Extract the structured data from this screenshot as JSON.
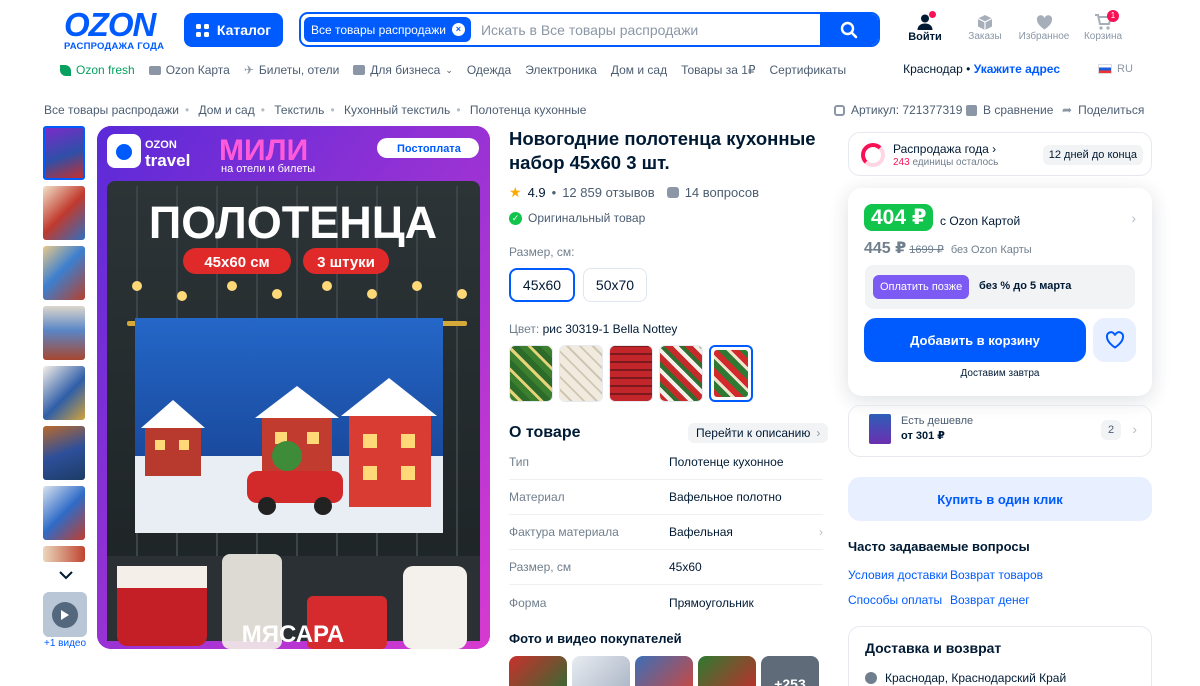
{
  "header": {
    "logo": "OZON",
    "logo_sub": "РАСПРОДАЖА ГОДА",
    "catalog": "Каталог",
    "search_scope": "Все товары распродажи",
    "search_placeholder": "Искать в Все товары распродажи",
    "nav": [
      {
        "label": "Войти",
        "icon": "user-icon"
      },
      {
        "label": "Заказы",
        "icon": "box-icon"
      },
      {
        "label": "Избранное",
        "icon": "heart-icon"
      },
      {
        "label": "Корзина",
        "icon": "cart-icon",
        "count": "1"
      }
    ]
  },
  "subnav": {
    "items": [
      "Ozon fresh",
      "Ozon Карта",
      "Билеты, отели",
      "Для бизнеса",
      "Одежда",
      "Электроника",
      "Дом и сад",
      "Товары за 1₽",
      "Сертификаты"
    ],
    "city": "Краснодар",
    "address": "Укажите адрес",
    "lang": "RU"
  },
  "breadcrumbs": [
    "Все товары распродажи",
    "Дом и сад",
    "Текстиль",
    "Кухонный текстиль",
    "Полотенца кухонные"
  ],
  "meta": {
    "article": "Артикул: 721377319",
    "compare": "В сравнение",
    "share": "Поделиться"
  },
  "gallery": {
    "video_label": "+1 видео",
    "hero": {
      "brand1": "OZON",
      "brand2": "travel",
      "promo": "МИЛИ",
      "promo_sub": "на отели и билеты",
      "postpay": "Постоплата",
      "headline": "ПОЛОТЕНЦА",
      "tag_size": "45х60 см",
      "tag_qty": "3 штуки",
      "bottom": "МЯСАРА"
    }
  },
  "product": {
    "title": "Новогодние полотенца кухонные набор 45х60 3 шт.",
    "rating": "4.9",
    "reviews": "12 859 отзывов",
    "questions": "14 вопросов",
    "original": "Оригинальный товар",
    "size_label": "Размер, см:",
    "sizes": [
      "45x60",
      "50x70"
    ],
    "color_label": "Цвет:",
    "color_value": "рис 30319-1 Bella Nottey",
    "about_title": "О товаре",
    "go_description": "Перейти к описанию",
    "properties": [
      {
        "k": "Тип",
        "v": "Полотенце кухонное"
      },
      {
        "k": "Материал",
        "v": "Вафельное полотно"
      },
      {
        "k": "Фактура материала",
        "v": "Вафельная"
      },
      {
        "k": "Размер, см",
        "v": "45x60"
      },
      {
        "k": "Форма",
        "v": "Прямоугольник"
      }
    ],
    "photos_title": "Фото и видео покупателей",
    "photos_more": "+253"
  },
  "buybox": {
    "sale_title": "Распродажа года",
    "sale_count": "243",
    "sale_count_text": "единицы осталось",
    "sale_days": "12 дней до конца",
    "price": "404 ₽",
    "price_note": "с Ozon Картой",
    "price_regular": "445 ₽",
    "price_old": "1699 ₽",
    "price_regular_note": "без Ozon Карты",
    "pay_later": "Оплатить позже",
    "pay_later_note": "без % до 5 марта",
    "add_to_cart": "Добавить в корзину",
    "delivery_note": "Доставим завтра",
    "cheaper_title": "Есть дешевле",
    "cheaper_price": "от 301 ₽",
    "cheaper_count": "2",
    "one_click": "Купить в один клик",
    "faq_title": "Часто задаваемые вопросы",
    "faq_links": [
      "Условия доставки",
      "Возврат товаров",
      "Способы оплаты",
      "Возврат денег"
    ],
    "delivery_title": "Доставка и возврат",
    "delivery_address": "Краснодар, Краснодарский Край"
  },
  "colors": {
    "brand": "#005bff",
    "sale_green": "#10c44c",
    "accent_pink": "#f91155",
    "pay_later": "#7b5bf3"
  }
}
